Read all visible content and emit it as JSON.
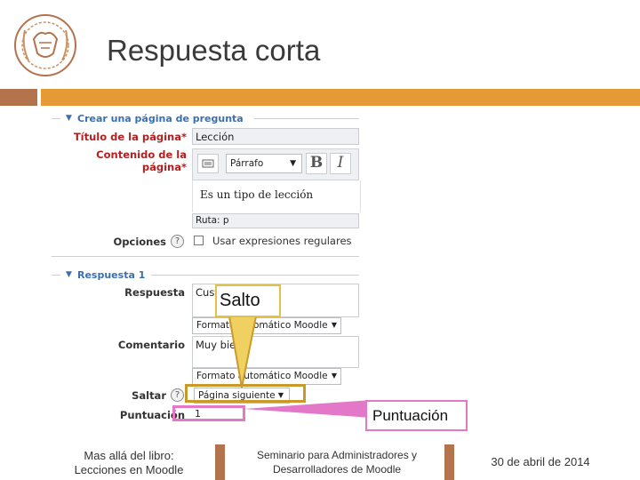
{
  "slide": {
    "title": "Respuesta corta",
    "colors": {
      "accent_brown": "#b3734c",
      "accent_orange": "#e69a36",
      "callout_gold": "#c99a2a",
      "callout_pink": "#e478c8",
      "required_red": "#b52020",
      "section_blue": "#3a6fb0"
    }
  },
  "form": {
    "section1": {
      "title": "Crear una página de pregunta"
    },
    "page_title_label": "Título de la página",
    "page_title_value": "Lección",
    "required_mark": "*",
    "content_label_1": "Contenido de la",
    "content_label_2": "página",
    "format_select": "Párrafo",
    "bold_icon": "bold-icon",
    "italic_icon": "italic-icon",
    "editor_text": "Es un tipo de lección",
    "path_text": "Ruta: p",
    "options_label": "Opciones",
    "help_icon": "help-icon",
    "regex_label": "Usar expresiones regulares",
    "section2": {
      "title": "Respuesta 1"
    },
    "answer_label": "Respuesta",
    "answer_value": "Custo",
    "format_label_1": "Formato automático Moodle",
    "comment_label": "Comentario",
    "comment_value": "Muy bie",
    "format_label_2": "Formato automático Moodle",
    "jump_label": "Saltar",
    "jump_value": "Página siguiente",
    "score_label": "Puntuación",
    "score_value": "1"
  },
  "callouts": {
    "jump": "Salto",
    "score": "Puntuación"
  },
  "footer": {
    "left_1": "Mas allá del libro:",
    "left_2": "Lecciones en Moodle",
    "center_1": "Seminario para Administradores y",
    "center_2": "Desarrolladores de Moodle",
    "date": "30 de abril de 2014"
  }
}
